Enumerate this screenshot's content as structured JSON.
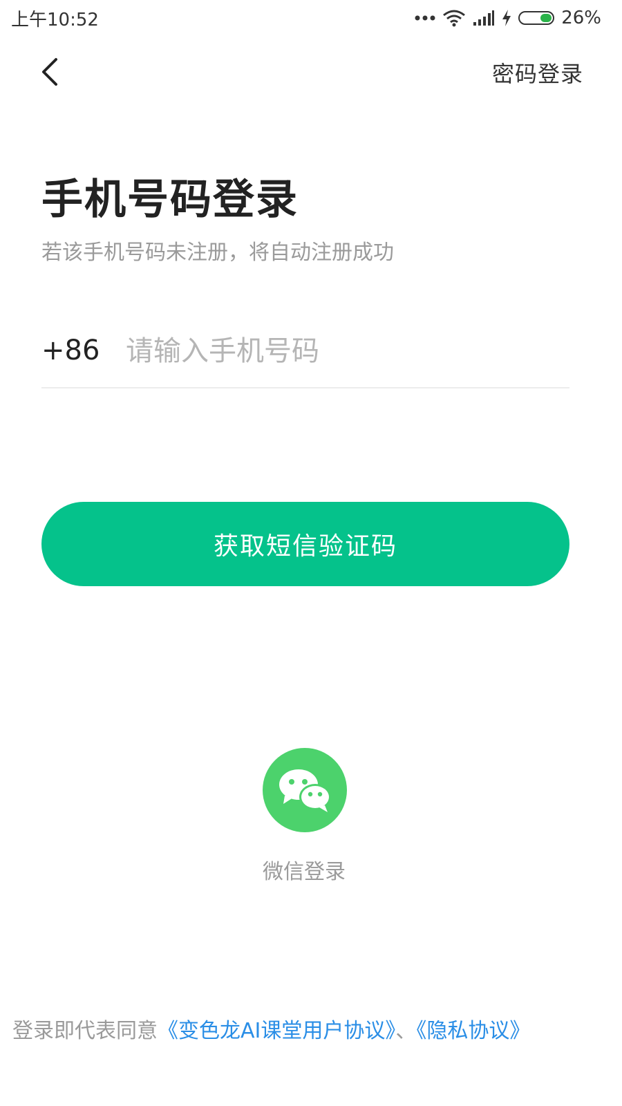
{
  "status_bar": {
    "time": "上午10:52",
    "battery_percent": "26%",
    "battery_level": 0.26,
    "battery_color": "#2bb34a"
  },
  "nav": {
    "back_icon": "chevron-left-icon",
    "password_login": "密码登录"
  },
  "title": "手机号码登录",
  "subtitle": "若该手机号码未注册，将自动注册成功",
  "phone": {
    "country_code": "+86",
    "placeholder": "请输入手机号码",
    "value": ""
  },
  "sms_button": {
    "label": "获取短信验证码",
    "color": "#05c28b"
  },
  "wechat": {
    "icon": "wechat-icon",
    "label": "微信登录",
    "color": "#4cd26c"
  },
  "agreement": {
    "prefix": "登录即代表同意",
    "user_agreement": "《变色龙AI课堂用户协议》",
    "separator": "、",
    "privacy_policy": "《隐私协议》",
    "link_color": "#2a8ee6"
  }
}
